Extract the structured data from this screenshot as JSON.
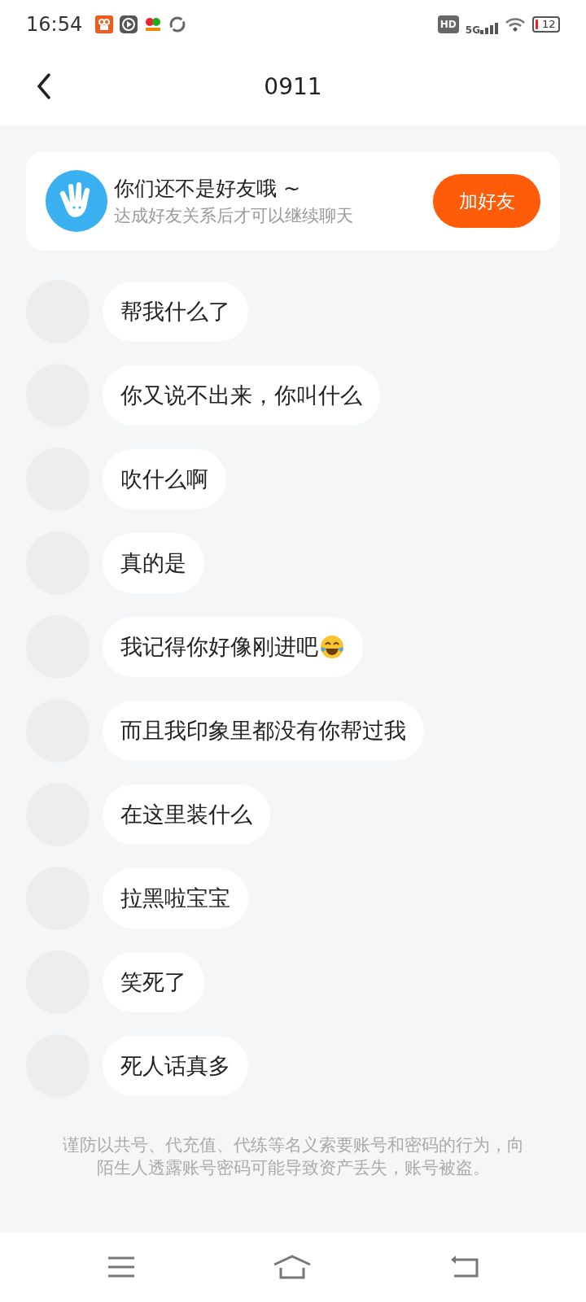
{
  "status_bar": {
    "time": "16:54",
    "network": "5G",
    "hd": "HD",
    "battery": "12"
  },
  "header": {
    "title": "0911"
  },
  "friend_banner": {
    "title": "你们还不是好友哦 ~",
    "subtitle": "达成好友关系后才可以继续聊天",
    "button": "加好友"
  },
  "messages": [
    {
      "text": "帮我什么了",
      "emoji": false
    },
    {
      "text": "你又说不出来，你叫什么",
      "emoji": false
    },
    {
      "text": "吹什么啊",
      "emoji": false
    },
    {
      "text": "真的是",
      "emoji": false
    },
    {
      "text": "我记得你好像刚进吧",
      "emoji": true
    },
    {
      "text": "而且我印象里都没有你帮过我",
      "emoji": false
    },
    {
      "text": "在这里装什么",
      "emoji": false
    },
    {
      "text": "拉黑啦宝宝",
      "emoji": false
    },
    {
      "text": "笑死了",
      "emoji": false
    },
    {
      "text": "死人话真多",
      "emoji": false
    }
  ],
  "warning": "谨防以共号、代充值、代练等名义索要账号和密码的行为，向陌生人透露账号密码可能导致资产丢失，账号被盗。"
}
